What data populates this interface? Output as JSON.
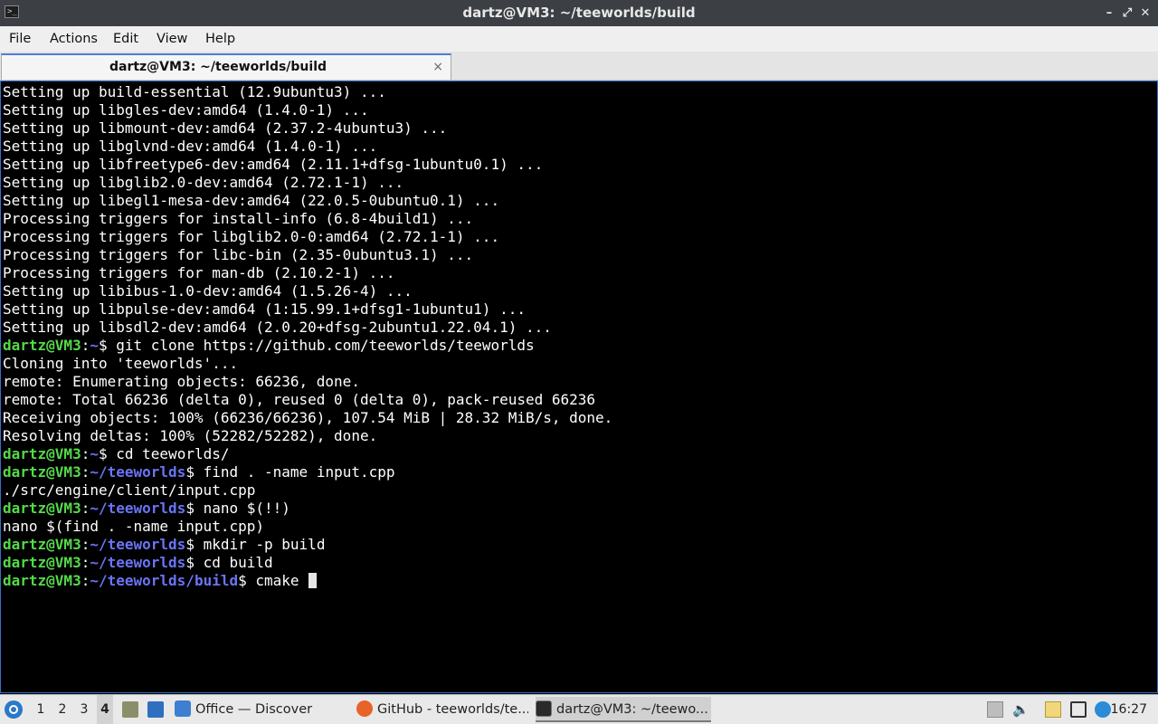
{
  "window": {
    "title": "dartz@VM3: ~/teeworlds/build",
    "app_icon_glyph": ">_"
  },
  "window_controls": {
    "minimize": "–",
    "restore": "⤢",
    "close": "✕"
  },
  "menu": [
    "File",
    "Actions",
    "Edit",
    "View",
    "Help"
  ],
  "tab": {
    "label": "dartz@VM3: ~/teeworlds/build",
    "close": "×"
  },
  "terminal": {
    "lines": [
      {
        "text": "Setting up build-essential (12.9ubuntu3) ..."
      },
      {
        "text": "Setting up libgles-dev:amd64 (1.4.0-1) ..."
      },
      {
        "text": "Setting up libmount-dev:amd64 (2.37.2-4ubuntu3) ..."
      },
      {
        "text": "Setting up libglvnd-dev:amd64 (1.4.0-1) ..."
      },
      {
        "text": "Setting up libfreetype6-dev:amd64 (2.11.1+dfsg-1ubuntu0.1) ..."
      },
      {
        "text": "Setting up libglib2.0-dev:amd64 (2.72.1-1) ..."
      },
      {
        "text": "Setting up libegl1-mesa-dev:amd64 (22.0.5-0ubuntu0.1) ..."
      },
      {
        "text": "Processing triggers for install-info (6.8-4build1) ..."
      },
      {
        "text": "Processing triggers for libglib2.0-0:amd64 (2.72.1-1) ..."
      },
      {
        "text": "Processing triggers for libc-bin (2.35-0ubuntu3.1) ..."
      },
      {
        "text": "Processing triggers for man-db (2.10.2-1) ..."
      },
      {
        "text": "Setting up libibus-1.0-dev:amd64 (1.5.26-4) ..."
      },
      {
        "text": "Setting up libpulse-dev:amd64 (1:15.99.1+dfsg1-1ubuntu1) ..."
      },
      {
        "text": "Setting up libsdl2-dev:amd64 (2.0.20+dfsg-2ubuntu1.22.04.1) ..."
      },
      {
        "prompt": {
          "user": "dartz@VM3",
          "path": "~"
        },
        "cmd": " git clone https://github.com/teeworlds/teeworlds"
      },
      {
        "text": "Cloning into 'teeworlds'..."
      },
      {
        "text": "remote: Enumerating objects: 66236, done."
      },
      {
        "text": "remote: Total 66236 (delta 0), reused 0 (delta 0), pack-reused 66236"
      },
      {
        "text": "Receiving objects: 100% (66236/66236), 107.54 MiB | 28.32 MiB/s, done."
      },
      {
        "text": "Resolving deltas: 100% (52282/52282), done."
      },
      {
        "prompt": {
          "user": "dartz@VM3",
          "path": "~"
        },
        "cmd": " cd teeworlds/"
      },
      {
        "prompt": {
          "user": "dartz@VM3",
          "path": "~/teeworlds"
        },
        "cmd": " find . -name input.cpp"
      },
      {
        "text": "./src/engine/client/input.cpp"
      },
      {
        "prompt": {
          "user": "dartz@VM3",
          "path": "~/teeworlds"
        },
        "cmd": " nano $(!!)"
      },
      {
        "text": "nano $(find . -name input.cpp)"
      },
      {
        "prompt": {
          "user": "dartz@VM3",
          "path": "~/teeworlds"
        },
        "cmd": " mkdir -p build"
      },
      {
        "prompt": {
          "user": "dartz@VM3",
          "path": "~/teeworlds"
        },
        "cmd": " cd build"
      },
      {
        "prompt": {
          "user": "dartz@VM3",
          "path": "~/teeworlds/build"
        },
        "cmd": " cmake ",
        "cursor": true
      }
    ]
  },
  "taskbar": {
    "workspaces": [
      "1",
      "2",
      "3",
      "4"
    ],
    "active_workspace": "4",
    "tasks": [
      {
        "label": "Office — Discover",
        "icon": "discover-icon"
      },
      {
        "label": "GitHub - teeworlds/te...",
        "icon": "firefox-icon"
      },
      {
        "label": "dartz@VM3: ~/teewo...",
        "icon": "terminal-icon"
      }
    ],
    "clock": "16:27"
  },
  "colors": {
    "prompt_user": "#55d94a",
    "prompt_path": "#6a74f5",
    "titlebar": "#3c3f44",
    "terminal_bg": "#000000",
    "accent": "#3a6fc4"
  }
}
